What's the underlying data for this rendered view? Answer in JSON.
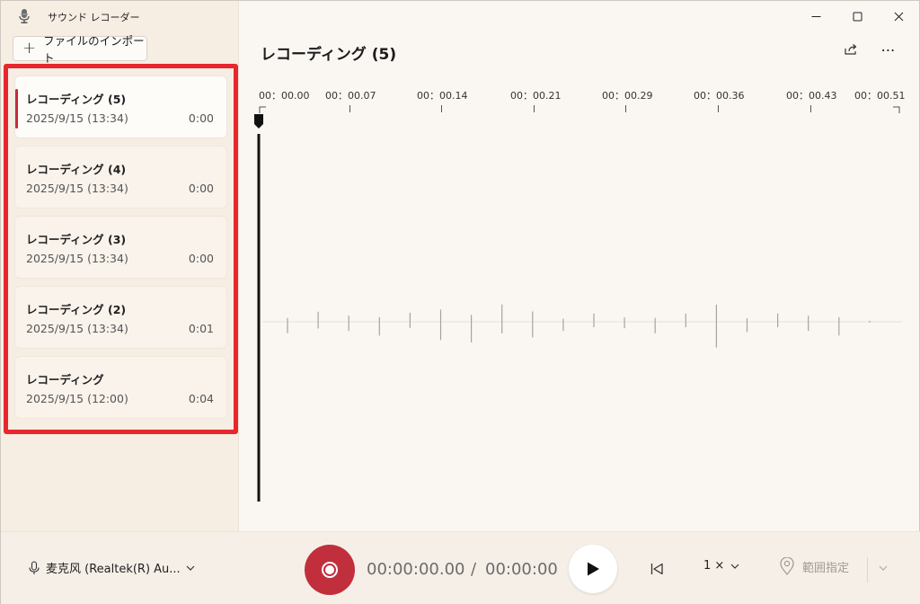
{
  "app": {
    "title": "サウンド レコーダー"
  },
  "sidebar": {
    "import_label": "ファイルのインポート",
    "recordings": [
      {
        "name": "レコーディング (5)",
        "date": "2025/9/15 (13:34)",
        "duration": "0:00",
        "selected": true
      },
      {
        "name": "レコーディング (4)",
        "date": "2025/9/15 (13:34)",
        "duration": "0:00",
        "selected": false
      },
      {
        "name": "レコーディング (3)",
        "date": "2025/9/15 (13:34)",
        "duration": "0:00",
        "selected": false
      },
      {
        "name": "レコーディング (2)",
        "date": "2025/9/15 (13:34)",
        "duration": "0:01",
        "selected": false
      },
      {
        "name": "レコーディング",
        "date": "2025/9/15 (12:00)",
        "duration": "0:04",
        "selected": false
      }
    ]
  },
  "main": {
    "title": "レコーディング (5)",
    "ticks": [
      "00：00.00",
      "00：00.07",
      "00：00.14",
      "00：00.21",
      "00：00.29",
      "00：00.36",
      "00：00.43",
      "00：00.51"
    ],
    "waveform_amplitudes": [
      0.5,
      0.55,
      0.5,
      0.6,
      0.5,
      1.0,
      0.9,
      0.95,
      0.85,
      0.4,
      0.45,
      0.35,
      0.5,
      0.45,
      1.4,
      0.45,
      0.45,
      0.5,
      0.6,
      0.05
    ]
  },
  "controls": {
    "mic_label": "麦克风 (Realtek(R) Au...",
    "time_current": "00:00:00.00",
    "time_separator": "/",
    "time_total": "00:00:00",
    "speed_label": "1 ×",
    "range_label": "範囲指定"
  },
  "colors": {
    "accent": "#c12f3d",
    "highlight_border": "#e8262d"
  }
}
